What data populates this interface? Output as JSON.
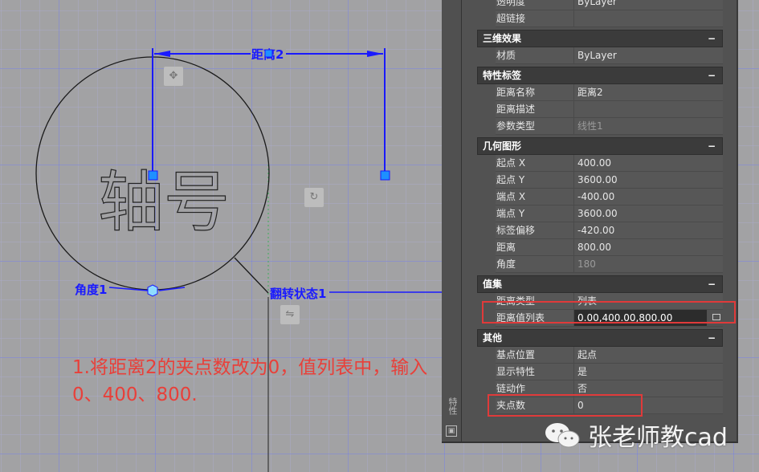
{
  "drawing": {
    "circle_text": "轴号",
    "param_distance_label": "距离2",
    "param_angle_label": "角度1",
    "param_flip_label": "翻转状态1",
    "line_color": "#1a1aff",
    "grip_color": "#1e90ff"
  },
  "panel": {
    "strip_label": "特性",
    "strip_icon": "panel-pin-icon",
    "toggle_symbol": "−",
    "rows_top": [
      {
        "label": "透明度",
        "value": "ByLayer"
      },
      {
        "label": "超链接",
        "value": ""
      }
    ],
    "sections": [
      {
        "title": "三维效果",
        "rows": [
          {
            "label": "材质",
            "value": "ByLayer"
          }
        ]
      },
      {
        "title": "特性标签",
        "rows": [
          {
            "label": "距离名称",
            "value": "距离2"
          },
          {
            "label": "距离描述",
            "value": ""
          },
          {
            "label": "参数类型",
            "value": "线性1"
          }
        ]
      },
      {
        "title": "几何图形",
        "rows": [
          {
            "label": "起点 X",
            "value": "400.00"
          },
          {
            "label": "起点 Y",
            "value": "3600.00"
          },
          {
            "label": "端点 X",
            "value": "-400.00"
          },
          {
            "label": "端点 Y",
            "value": "3600.00"
          },
          {
            "label": "标签偏移",
            "value": "-420.00"
          },
          {
            "label": "距离",
            "value": "800.00"
          },
          {
            "label": "角度",
            "value": "180"
          }
        ]
      },
      {
        "title": "值集",
        "rows": [
          {
            "label": "距离类型",
            "value": "列表"
          },
          {
            "label": "距离值列表",
            "value": "0.00,400.00,800.00"
          }
        ]
      },
      {
        "title": "其他",
        "rows": [
          {
            "label": "基点位置",
            "value": "起点"
          },
          {
            "label": "显示特性",
            "value": "是"
          },
          {
            "label": "链动作",
            "value": "否"
          },
          {
            "label": "夹点数",
            "value": "0"
          }
        ]
      }
    ]
  },
  "annotation": {
    "line1": "1.将距离2的夹点数改为0，值列表中，输入",
    "line2": "0、400、800.",
    "color": "#e8403a"
  },
  "watermark": {
    "text": "张老师教cad",
    "icon": "wechat-icon"
  }
}
